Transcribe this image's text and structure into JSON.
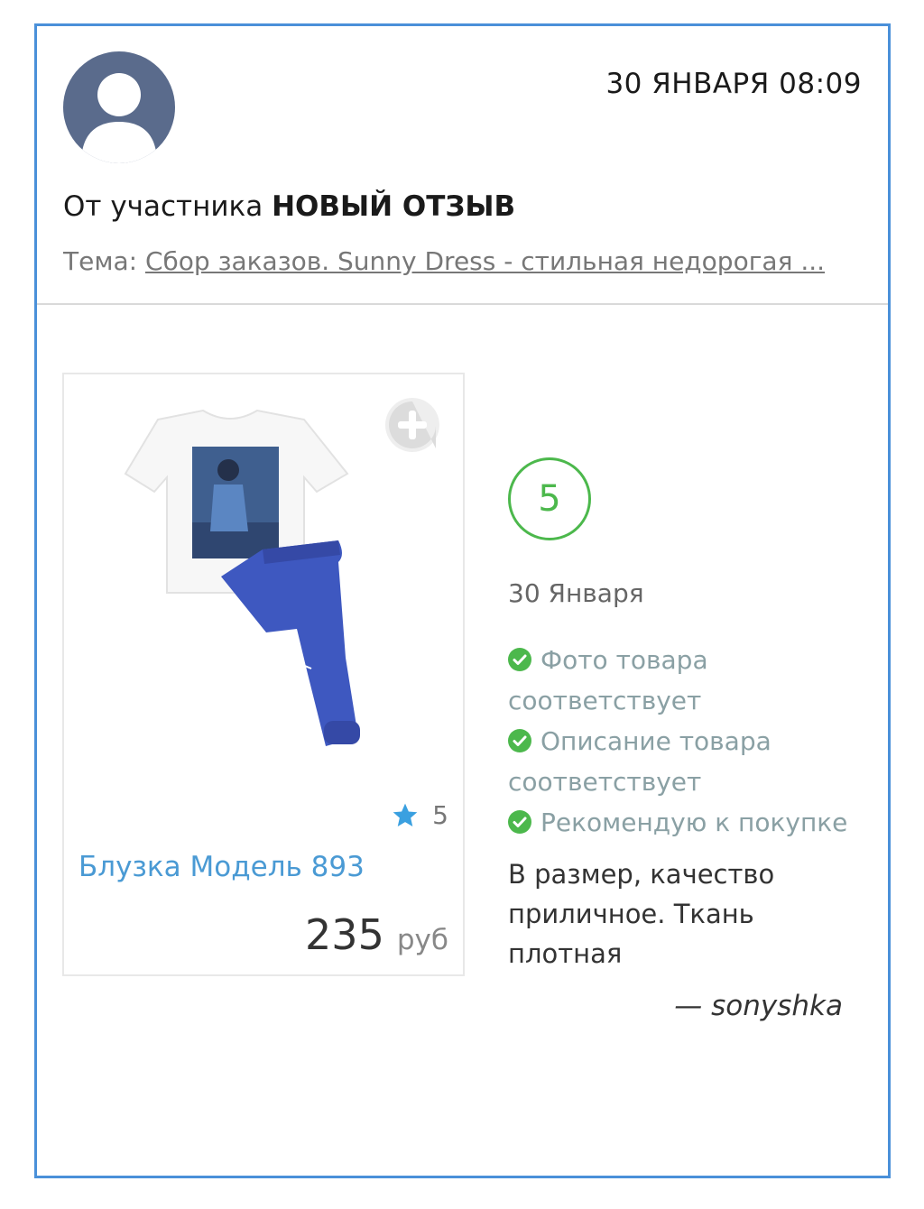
{
  "header": {
    "datetime": "30 ЯНВАРЯ 08:09",
    "from_prefix": "От участника",
    "from_name": "НОВЫЙ ОТЗЫВ",
    "topic_label": "Тема:",
    "topic_link": "Сбор заказов. Sunny Dress - стильная недорогая ..."
  },
  "product": {
    "name": "Блузка Модель 893",
    "rating": "5",
    "price": "235",
    "currency": "руб"
  },
  "review": {
    "score": "5",
    "date": "30 Января",
    "checks": [
      "Фото товара соответствует",
      "Описание товара соответствует",
      "Рекомендую к покупке"
    ],
    "text": "В размер, качество приличное. Ткань плотная",
    "author": "— sonyshka"
  },
  "colors": {
    "frame": "#4a90d9",
    "accent_green": "#4cb84c",
    "link_blue": "#4a9ad4",
    "star_blue": "#3aa0e0"
  },
  "icons": {
    "avatar": "user-silhouette-icon",
    "add": "plus-icon",
    "star": "star-icon",
    "check": "check-circle-icon"
  }
}
